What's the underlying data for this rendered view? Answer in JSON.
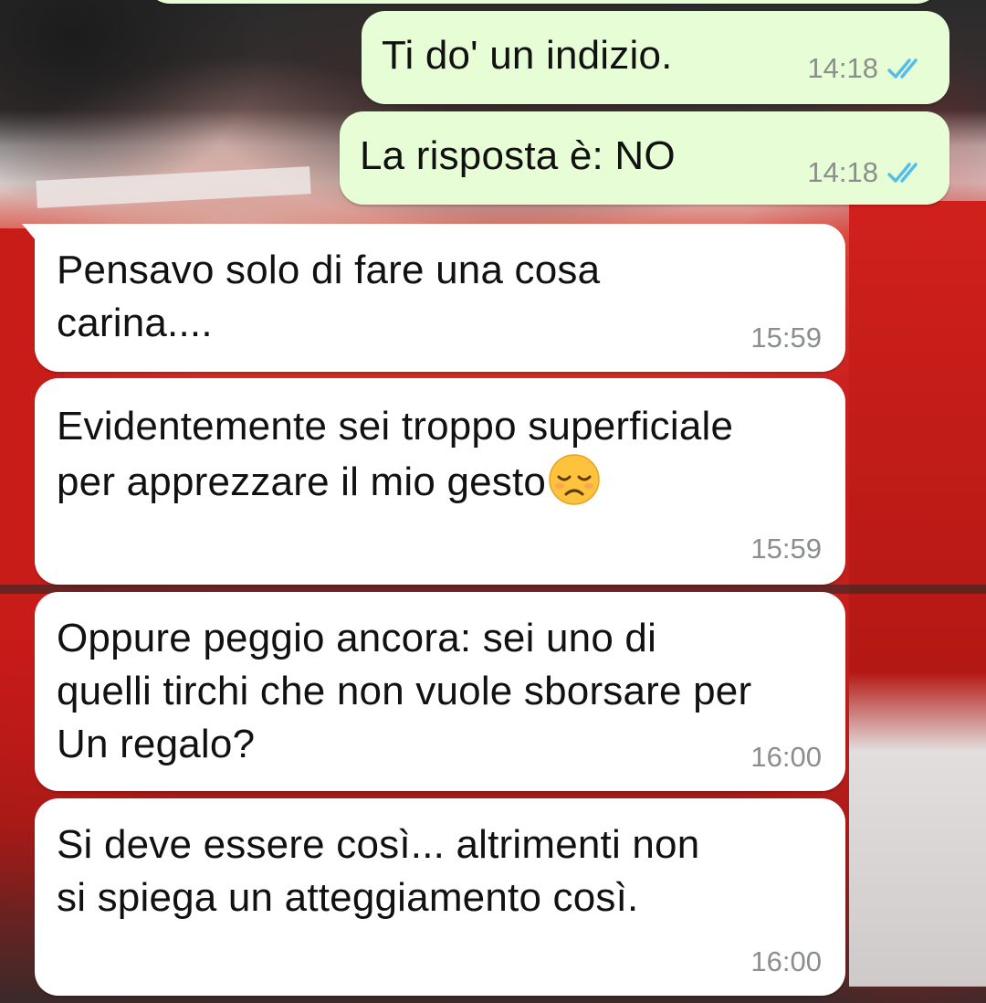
{
  "messages": [
    {
      "direction": "outgoing",
      "text": "Ti do' un indizio.",
      "time": "14:18",
      "status_icon": "double-check-read-icon"
    },
    {
      "direction": "outgoing",
      "text": "La risposta è: NO",
      "time": "14:18",
      "status_icon": "double-check-read-icon"
    },
    {
      "direction": "incoming",
      "text": "Pensavo solo di fare una cosa\ncarina....",
      "time": "15:59"
    },
    {
      "direction": "incoming",
      "text_before_emoji": "Evidentemente sei troppo superficiale\nper apprezzare il mio gesto",
      "emoji": "disappointed-face-icon",
      "time": "15:59"
    },
    {
      "direction": "incoming",
      "text": "Oppure peggio ancora: sei uno di\nquelli tirchi che non vuole sborsare per\nUn regalo?",
      "time": "16:00"
    },
    {
      "direction": "incoming",
      "text": "Si deve essere così... altrimenti non\nsi spiega un atteggiamento così.",
      "time": "16:00"
    }
  ],
  "colors": {
    "outgoing_bubble": "#e7fdd6",
    "incoming_bubble": "#ffffff",
    "read_ticks": "#53bdeb",
    "timestamp": "#8b8f8b"
  }
}
